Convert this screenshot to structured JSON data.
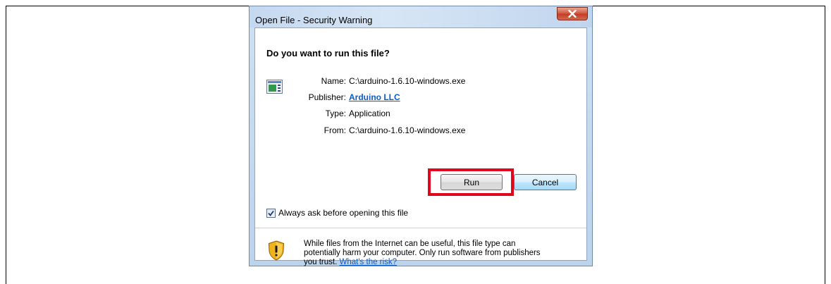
{
  "dialog": {
    "title": "Open File - Security Warning",
    "question": "Do you want to run this file?",
    "info": {
      "name_label": "Name:",
      "name_value": "C:\\arduino-1.6.10-windows.exe",
      "publisher_label": "Publisher:",
      "publisher_value": "Arduino LLC",
      "type_label": "Type:",
      "type_value": "Application",
      "from_label": "From:",
      "from_value": "C:\\arduino-1.6.10-windows.exe"
    },
    "buttons": {
      "run_label": "Run",
      "cancel_label": "Cancel"
    },
    "checkbox": {
      "label": "Always ask before opening this file",
      "checked": true
    },
    "warning": {
      "text_line1": "While files from the Internet can be useful, this file type can",
      "text_line2": "potentially harm your computer. Only run software from publishers",
      "text_line3": "you trust.",
      "risk_link": "What's the risk?"
    }
  },
  "icons": {
    "close": "close-icon",
    "file": "application-file-icon",
    "shield": "security-shield-icon",
    "checkmark": "checkmark-icon"
  },
  "colors": {
    "highlight_box": "#e0071c",
    "link": "#0d5bc4",
    "close_button": "#c13b22"
  }
}
